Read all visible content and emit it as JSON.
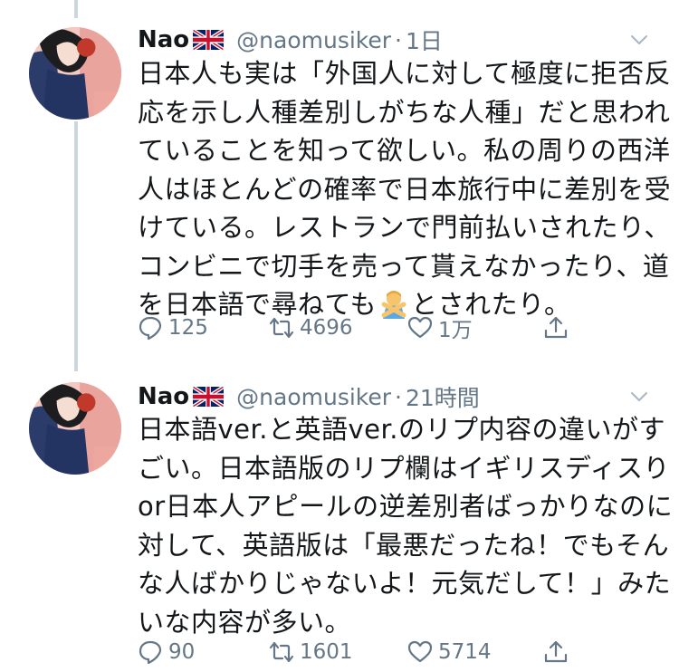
{
  "tweets": [
    {
      "name": "Nao",
      "handle": "@naomusiker",
      "separator": "·",
      "time": "1日",
      "lines": [
        "日本人も実は「外国人に対して極度に拒否反",
        "応を示し人種差別しがちな人種」だと思われ",
        "ていることを知って欲しい。私の周りの西洋",
        "人はほとんどの確率で日本旅行中に差別を受",
        "けている。レストランで門前払いされたり、",
        "コンビニで切手を売って貰えなかったり、道"
      ],
      "last_line_before": "を日本語で尋ねても",
      "last_line_emoji": "person-gesturing-no-icon",
      "last_line_after": "とされたり。",
      "replies": "125",
      "retweets": "4696",
      "likes": "1万"
    },
    {
      "name": "Nao",
      "handle": "@naomusiker",
      "separator": "·",
      "time": "21時間",
      "lines": [
        "日本語ver.と英語ver.のリプ内容の違いがす",
        "ごい。日本語版のリプ欄はイギリスディスり",
        "or日本人アピールの逆差別者ばっかりなのに",
        "対して、英語版は「最悪だったね！でもそん",
        "な人ばかりじゃないよ！元気だして！」みた",
        "いな内容が多い。"
      ],
      "replies": "90",
      "retweets": "1601",
      "likes": "5714"
    }
  ],
  "icons": {
    "flag": "uk-flag-icon",
    "reply": "reply-icon",
    "retweet": "retweet-icon",
    "like": "heart-icon",
    "share": "share-icon",
    "caret": "chevron-down-icon"
  },
  "colors": {
    "text": "#14171a",
    "secondary": "#657786",
    "thread_line": "#ccd6dd"
  }
}
